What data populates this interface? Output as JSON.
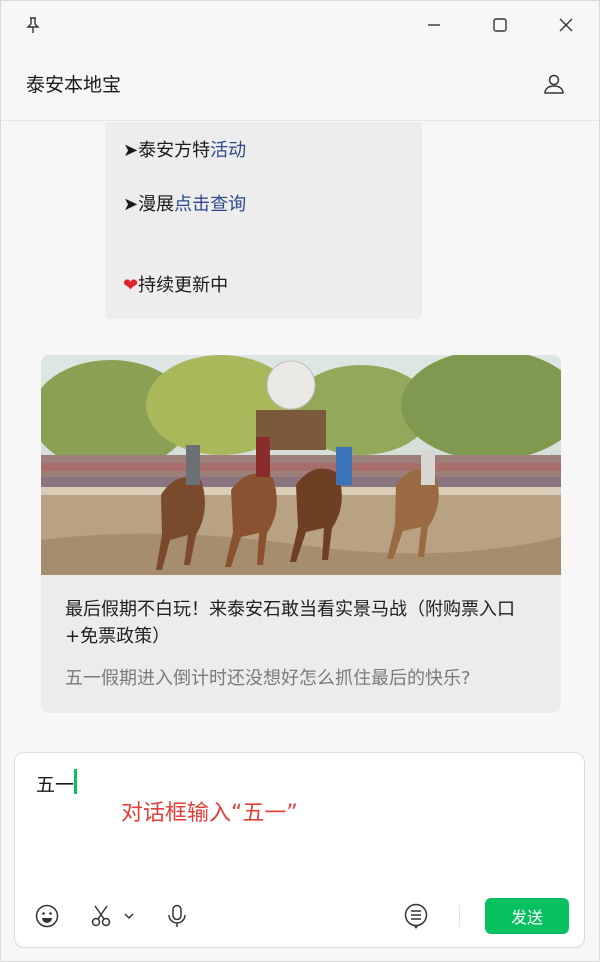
{
  "window": {
    "pin_icon": "pin-icon",
    "minimize_icon": "minimize-icon",
    "maximize_icon": "maximize-icon",
    "close_icon": "close-icon"
  },
  "chat": {
    "title": "泰安本地宝",
    "profile_icon": "person-icon"
  },
  "message": {
    "line1_prefix": "➤泰安方特",
    "line1_link": "活动",
    "line2_prefix": "➤漫展",
    "line2_link": "点击查询",
    "line3_heart": "❤",
    "line3_text": "持续更新中"
  },
  "card": {
    "image_desc": "horse-battle-photo",
    "title": "最后假期不白玩！来泰安石敢当看实景马战（附购票入口+免票政策）",
    "description": "五一假期进入倒计时还没想好怎么抓住最后的快乐?"
  },
  "composer": {
    "input_value": "五一",
    "annotation": "对话框输入“五一”",
    "tools": [
      "emoji-icon",
      "scissors-icon",
      "microphone-icon",
      "chat-history-icon"
    ],
    "send_label": "发送"
  },
  "colors": {
    "accent": "#07c160",
    "link": "#2b4a8a",
    "annotation": "#e2403a"
  }
}
